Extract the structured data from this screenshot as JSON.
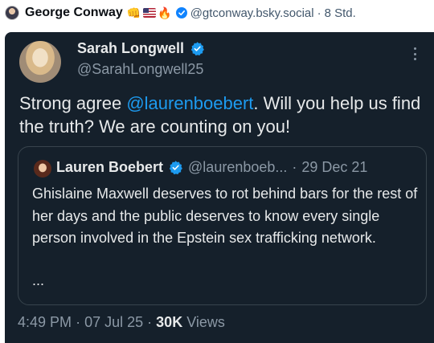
{
  "post": {
    "author_name": "George Conway",
    "handle": "@gtconway.bsky.social",
    "separator": "·",
    "time_ago": "8 Std.",
    "emoji_fist": "👊",
    "emoji_fire": "🔥"
  },
  "tweet": {
    "author_name": "Sarah Longwell",
    "author_handle": "@SarahLongwell25",
    "text_before": "Strong agree ",
    "mention": "@laurenboebert",
    "text_after": ". Will you help us find the truth? We are counting on you!",
    "time": "4:49 PM",
    "date": "07 Jul 25",
    "views_count": "30K",
    "views_label": "Views",
    "separator": "·"
  },
  "quote": {
    "author_name": "Lauren Boebert",
    "author_handle": "@laurenboeb...",
    "separator": "·",
    "date": "29 Dec 21",
    "text": "Ghislaine Maxwell deserves to rot behind bars for the rest of her days and the public deserves to know every single person involved in the Epstein sex trafficking network.",
    "ellipsis": "..."
  },
  "colors": {
    "tweet_background": "#15202b",
    "mention": "#1d9bf0",
    "verified": "#1d9bf0"
  },
  "icons": [
    "avatar",
    "verified-badge-icon",
    "more-options-icon",
    "us-flag-icon"
  ]
}
